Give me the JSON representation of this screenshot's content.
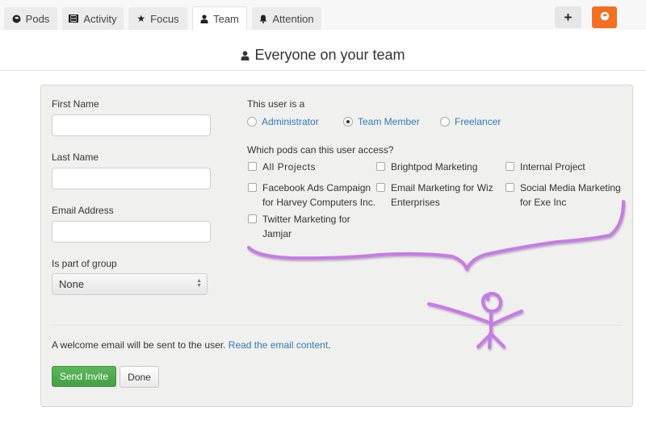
{
  "nav": {
    "tabs": [
      {
        "label": "Pods",
        "icon": "pod-icon",
        "active": false
      },
      {
        "label": "Activity",
        "icon": "film-icon",
        "active": false
      },
      {
        "label": "Focus",
        "icon": "star-icon",
        "active": false
      },
      {
        "label": "Team",
        "icon": "user-icon",
        "active": true
      },
      {
        "label": "Attention",
        "icon": "bell-icon",
        "active": false
      }
    ],
    "add_label": "+",
    "brand_icon": "brightpod-logo-icon"
  },
  "page": {
    "title": "Everyone on your team",
    "title_icon": "user-icon"
  },
  "form": {
    "first_name": {
      "label": "First Name",
      "value": "",
      "placeholder": ""
    },
    "last_name": {
      "label": "Last Name",
      "value": "",
      "placeholder": ""
    },
    "email": {
      "label": "Email Address",
      "value": "",
      "placeholder": ""
    },
    "group": {
      "label": "Is part of group",
      "selected": "None"
    },
    "role": {
      "label": "This user is a",
      "options": [
        "Administrator",
        "Team Member",
        "Freelancer"
      ],
      "selected": "Team Member"
    },
    "pods": {
      "label": "Which pods can this user access?",
      "items": [
        {
          "line1": "All Projects",
          "line2": "",
          "checked": false
        },
        {
          "line1": "Brightpod Marketing",
          "line2": "",
          "checked": false
        },
        {
          "line1": "Internal Project",
          "line2": "",
          "checked": false
        },
        {
          "line1": "Facebook Ads Campaign",
          "line2": "for Harvey Computers Inc.",
          "checked": false
        },
        {
          "line1": "Email Marketing for Wiz",
          "line2": "Enterprises",
          "checked": false
        },
        {
          "line1": "Social Media Marketing",
          "line2": "for Exe Inc",
          "checked": false
        },
        {
          "line1": "Twitter Marketing for",
          "line2": "Jamjar",
          "checked": false
        }
      ]
    },
    "note_text": "A welcome email will be sent to the user.",
    "note_link": "Read the email content",
    "note_end": ".",
    "send_label": "Send Invite",
    "done_label": "Done"
  },
  "colors": {
    "accent_link": "#2e7bb8",
    "brand_orange": "#f36f21",
    "send_green": "#4cae4c",
    "annotation_purple": "#c77be6"
  },
  "annotation": {
    "type": "hand-drawn brace and stick figure",
    "color": "#c77be6"
  }
}
